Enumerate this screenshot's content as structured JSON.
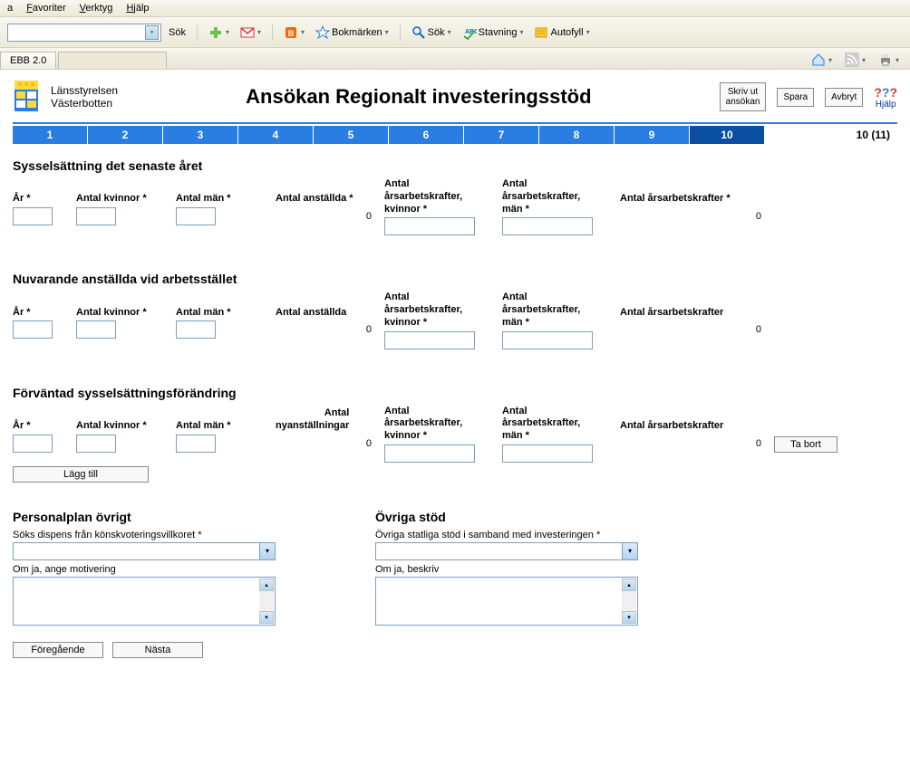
{
  "menubar": {
    "arkiv": "a",
    "favoriter": "Favoriter",
    "verktyg": "Verktyg",
    "hjalp": "Hjälp"
  },
  "toolbar": {
    "sok": "Sök",
    "bokmarken": "Bokmärken",
    "sok2": "Sök",
    "stavning": "Stavning",
    "autofyll": "Autofyll"
  },
  "tabs": {
    "tab1": "EBB 2.0",
    "tab2": ""
  },
  "header": {
    "org1": "Länsstyrelsen",
    "org2": "Västerbotten",
    "title": "Ansökan Regionalt investeringsstöd",
    "btn_print": "Skriv ut\nansökan",
    "btn_save": "Spara",
    "btn_cancel": "Avbryt",
    "help_label": "Hjälp"
  },
  "steps": {
    "labels": [
      "1",
      "2",
      "3",
      "4",
      "5",
      "6",
      "7",
      "8",
      "9",
      "10"
    ],
    "active": 10,
    "counter": "10 (11)"
  },
  "sections": {
    "s1": {
      "title": "Sysselsättning det senaste året",
      "ar": "År *",
      "kvinnor": "Antal kvinnor *",
      "man": "Antal män *",
      "anstallda": "Antal anställda *",
      "ars_k": "Antal\nårsarbetskrafter,\nkvinnor *",
      "ars_m": "Antal\nårsarbetskrafter,\nmän *",
      "ars_tot": "Antal årsarbetskrafter *",
      "val_anst": "0",
      "val_tot": "0"
    },
    "s2": {
      "title": "Nuvarande anställda vid arbetsstället",
      "ar": "År *",
      "kvinnor": "Antal kvinnor *",
      "man": "Antal män *",
      "anstallda": "Antal anställda",
      "ars_k": "Antal\nårsarbetskrafter,\nkvinnor *",
      "ars_m": "Antal\nårsarbetskrafter,\nmän *",
      "ars_tot": "Antal årsarbetskrafter",
      "val_anst": "0",
      "val_tot": "0"
    },
    "s3": {
      "title": "Förväntad sysselsättningsförändring",
      "ar": "År *",
      "kvinnor": "Antal kvinnor *",
      "man": "Antal män *",
      "anstallda": "Antal\nnyanställningar",
      "ars_k": "Antal\nårsarbetskrafter,\nkvinnor *",
      "ars_m": "Antal\nårsarbetskrafter,\nmän *",
      "ars_tot": "Antal årsarbetskrafter",
      "val_anst": "0",
      "val_tot": "0",
      "tabort": "Ta bort",
      "laggtill": "Lägg till"
    },
    "s4": {
      "title_left": "Personalplan övrigt",
      "left_q": "Söks dispens från könskvoteringsvillkoret *",
      "left_sub": "Om ja, ange motivering",
      "title_right": "Övriga stöd",
      "right_q": "Övriga statliga stöd i samband med investeringen *",
      "right_sub": "Om ja, beskriv"
    }
  },
  "nav": {
    "prev": "Föregående",
    "next": "Nästa"
  }
}
